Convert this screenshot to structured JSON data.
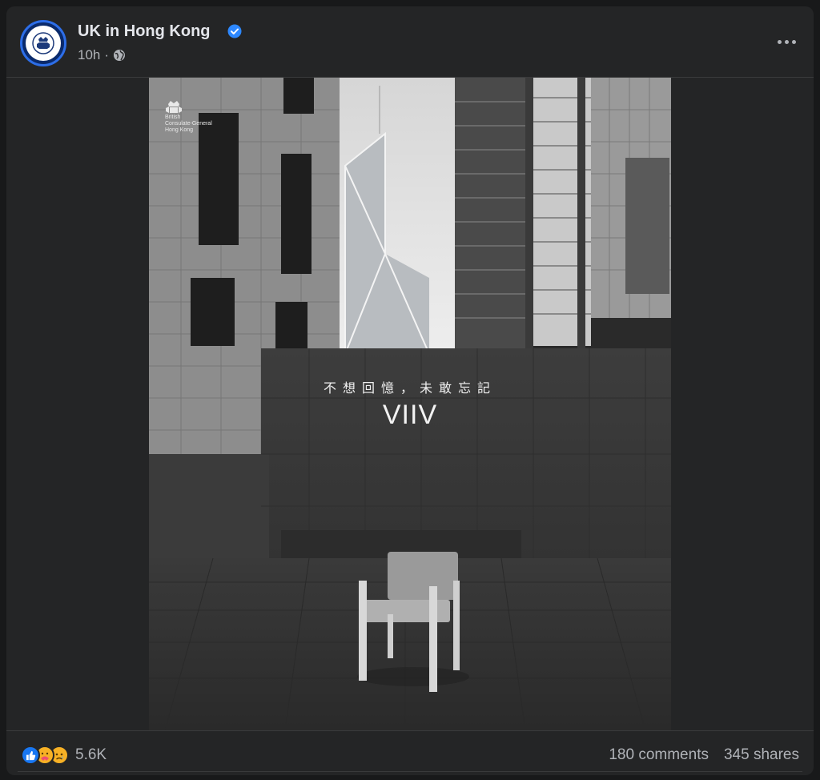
{
  "post": {
    "page_name": "UK in Hong Kong",
    "time": "10h",
    "separator": "·",
    "privacy_icon": "globe-icon",
    "verified_icon": "verified-badge-icon",
    "more_icon": "more-options-icon"
  },
  "image": {
    "logo_lines": [
      "British",
      "Consulate-General",
      "Hong Kong"
    ],
    "caption_cn": "不想回憶，未敢忘記",
    "caption_big": "VIIV"
  },
  "footer": {
    "reaction_icons": [
      "like-icon",
      "care-icon",
      "sad-icon"
    ],
    "reaction_count": "5.6K",
    "comments": "180 comments",
    "shares": "345 shares"
  },
  "colors": {
    "background": "#18191a",
    "card": "#242526",
    "primary_text": "#e4e6eb",
    "secondary_text": "#b0b3b8",
    "verified_blue": "#2d88ff",
    "like_blue": "#1877f2"
  }
}
